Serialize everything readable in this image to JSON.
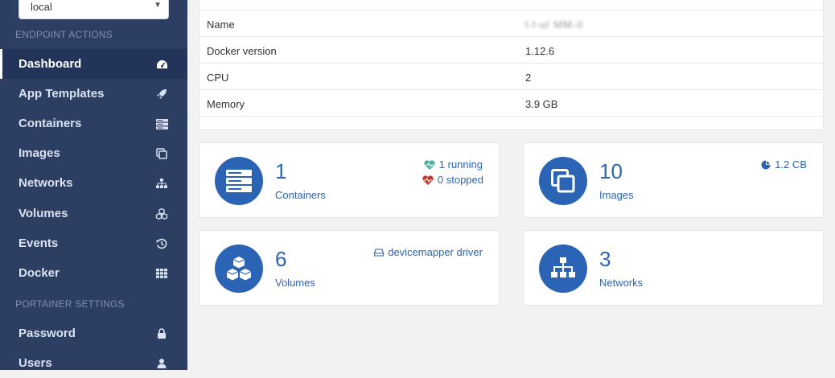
{
  "sidebar": {
    "endpoint": "local",
    "sections": {
      "endpoint_actions": "ENDPOINT ACTIONS",
      "portainer_settings": "PORTAINER SETTINGS"
    },
    "items": [
      {
        "label": "Dashboard",
        "icon": "dashboard-icon",
        "active": true
      },
      {
        "label": "App Templates",
        "icon": "rocket-icon"
      },
      {
        "label": "Containers",
        "icon": "server-icon"
      },
      {
        "label": "Images",
        "icon": "clone-icon"
      },
      {
        "label": "Networks",
        "icon": "sitemap-icon"
      },
      {
        "label": "Volumes",
        "icon": "cubes-icon"
      },
      {
        "label": "Events",
        "icon": "history-icon"
      },
      {
        "label": "Docker",
        "icon": "th-icon"
      },
      {
        "label": "Password",
        "icon": "lock-icon"
      },
      {
        "label": "Users",
        "icon": "user-icon"
      }
    ]
  },
  "info": {
    "rows": [
      {
        "key": "Name",
        "value": "l-l-ul MM-il"
      },
      {
        "key": "Docker version",
        "value": "1.12.6"
      },
      {
        "key": "CPU",
        "value": "2"
      },
      {
        "key": "Memory",
        "value": "3.9 GB"
      }
    ]
  },
  "widgets": {
    "containers": {
      "count": "1",
      "label": "Containers",
      "running": "1 running",
      "stopped": "0 stopped"
    },
    "images": {
      "count": "10",
      "label": "Images",
      "size": "1.2 CB"
    },
    "volumes": {
      "count": "6",
      "label": "Volumes",
      "driver": "devicemapper driver"
    },
    "networks": {
      "count": "3",
      "label": "Networks"
    }
  },
  "colors": {
    "sidebar": "#2d3e63",
    "accent": "#2b64b4",
    "running": "#4cae9b",
    "stopped": "#c0392b"
  }
}
